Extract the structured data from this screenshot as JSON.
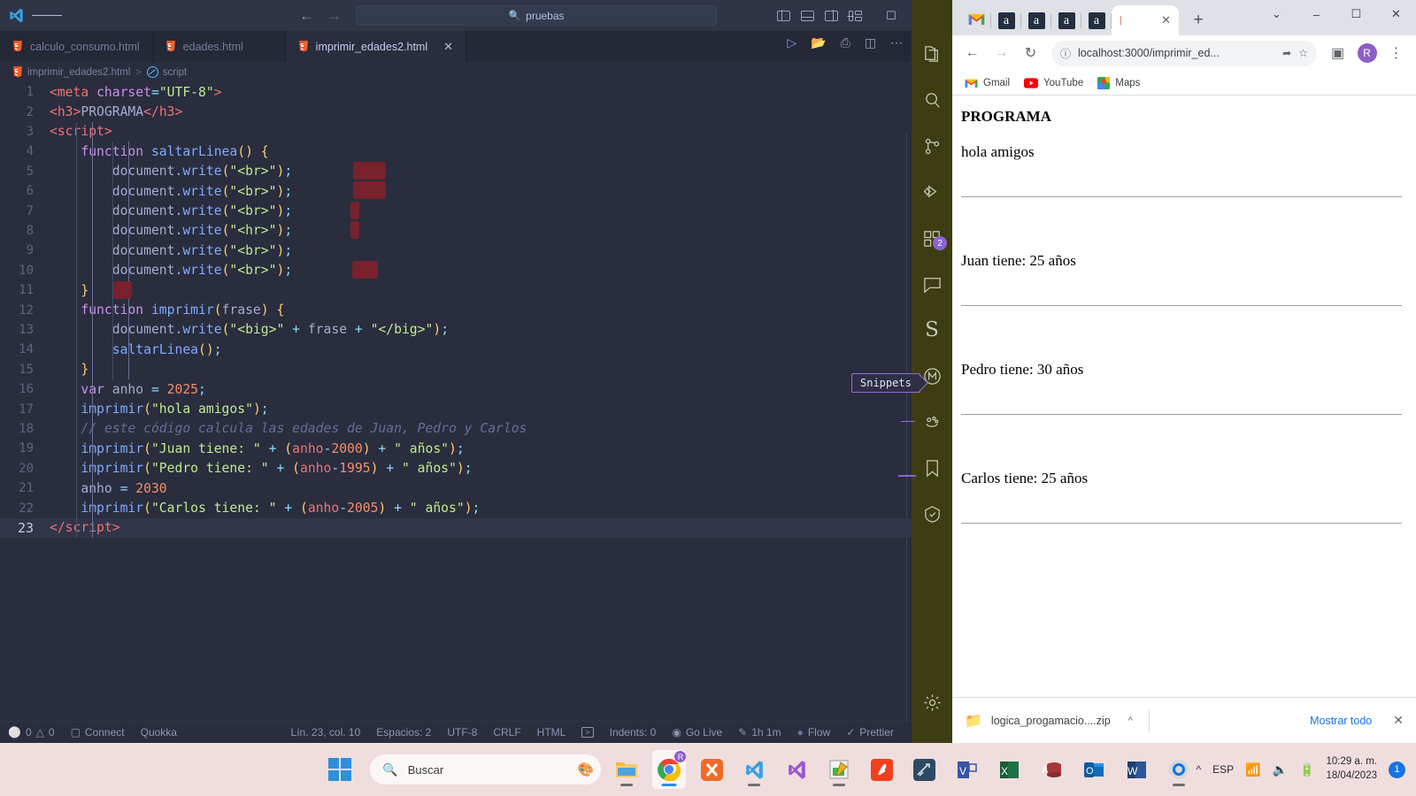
{
  "vscode": {
    "window_title": "pruebas",
    "search_placeholder": "pruebas",
    "tabs": [
      {
        "label": "calculo_consumo.html",
        "active": false
      },
      {
        "label": "edades.html",
        "active": false
      },
      {
        "label": "imprimir_edades2.html",
        "active": true
      }
    ],
    "breadcrumb": {
      "file": "imprimir_edades2.html",
      "symbol": "script",
      "separator": ">"
    },
    "tooltip": "Snippets",
    "code_lines": [
      {
        "n": "1",
        "html": "<span class='t-tag'>&lt;meta</span> <span class='t-attr'>charset</span><span class='t-op'>=</span><span class='t-str'>\"UTF-8\"</span><span class='t-tag'>&gt;</span>"
      },
      {
        "n": "2",
        "html": "<span class='t-tag'>&lt;h3&gt;</span><span class='t-pl'>PROGRAMA</span><span class='t-tag'>&lt;/</span><span class='t-tag'>h3&gt;</span>"
      },
      {
        "n": "3",
        "html": "<span class='t-tag'>&lt;script&gt;</span>"
      },
      {
        "n": "4",
        "html": "    <span class='t-kw'>function</span> <span class='t-fn'>saltarLinea</span><span class='t-par'>()</span> <span class='t-par'>{</span>"
      },
      {
        "n": "5",
        "html": "        <span class='t-var'>document</span><span class='t-pl'>.</span><span class='t-prop'>write</span><span class='t-par'>(</span><span class='t-str'>\"&lt;br&gt;\"</span><span class='t-par'>)</span><span class='t-op'>;</span>"
      },
      {
        "n": "6",
        "html": "        <span class='t-var'>document</span><span class='t-pl'>.</span><span class='t-prop'>write</span><span class='t-par'>(</span><span class='t-str'>\"&lt;br&gt;\"</span><span class='t-par'>)</span><span class='t-op'>;</span>"
      },
      {
        "n": "7",
        "html": "        <span class='t-var'>document</span><span class='t-pl'>.</span><span class='t-prop'>write</span><span class='t-par'>(</span><span class='t-str'>\"&lt;br&gt;\"</span><span class='t-par'>)</span><span class='t-op'>;</span>"
      },
      {
        "n": "8",
        "html": "        <span class='t-var'>document</span><span class='t-pl'>.</span><span class='t-prop'>write</span><span class='t-par'>(</span><span class='t-str'>\"&lt;hr&gt;\"</span><span class='t-par'>)</span><span class='t-op'>;</span>"
      },
      {
        "n": "9",
        "html": "        <span class='t-var'>document</span><span class='t-pl'>.</span><span class='t-prop'>write</span><span class='t-par'>(</span><span class='t-str'>\"&lt;br&gt;\"</span><span class='t-par'>)</span><span class='t-op'>;</span>"
      },
      {
        "n": "10",
        "html": "        <span class='t-var'>document</span><span class='t-pl'>.</span><span class='t-prop'>write</span><span class='t-par'>(</span><span class='t-str'>\"&lt;br&gt;\"</span><span class='t-par'>)</span><span class='t-op'>;</span>"
      },
      {
        "n": "11",
        "html": "    <span class='t-par'>}</span>"
      },
      {
        "n": "12",
        "html": "    <span class='t-kw'>function</span> <span class='t-fn'>imprimir</span><span class='t-par'>(</span><span class='t-pl'>frase</span><span class='t-par'>)</span> <span class='t-par'>{</span>"
      },
      {
        "n": "13",
        "html": "        <span class='t-var'>document</span><span class='t-pl'>.</span><span class='t-prop'>write</span><span class='t-par'>(</span><span class='t-str'>\"&lt;big&gt;\"</span> <span class='t-op'>+</span> <span class='t-pl'>frase</span> <span class='t-op'>+</span> <span class='t-str'>\"&lt;/big&gt;\"</span><span class='t-par'>)</span><span class='t-op'>;</span>"
      },
      {
        "n": "14",
        "html": "        <span class='t-fn'>saltarLinea</span><span class='t-par'>()</span><span class='t-op'>;</span>"
      },
      {
        "n": "15",
        "html": "    <span class='t-par'>}</span>"
      },
      {
        "n": "16",
        "html": "    <span class='t-kw'>var</span> <span class='t-pl'>anho</span> <span class='t-op'>=</span> <span class='t-num'>2025</span><span class='t-op'>;</span>"
      },
      {
        "n": "17",
        "html": "    <span class='t-fn'>imprimir</span><span class='t-par'>(</span><span class='t-str'>\"hola amigos\"</span><span class='t-par'>)</span><span class='t-op'>;</span>"
      },
      {
        "n": "18",
        "html": "    <span class='t-com'>// este código calcula las edades de Juan, Pedro y Carlos</span>"
      },
      {
        "n": "19",
        "html": "    <span class='t-fn'>imprimir</span><span class='t-par'>(</span><span class='t-str'>\"Juan tiene: \"</span> <span class='t-op'>+</span> <span class='t-par'>(</span><span class='t-tag'>anho</span><span class='t-op'>-</span><span class='t-num'>2000</span><span class='t-par'>)</span> <span class='t-op'>+</span> <span class='t-str'>\" años\"</span><span class='t-par'>)</span><span class='t-op'>;</span>"
      },
      {
        "n": "20",
        "html": "    <span class='t-fn'>imprimir</span><span class='t-par'>(</span><span class='t-str'>\"Pedro tiene: \"</span> <span class='t-op'>+</span> <span class='t-par'>(</span><span class='t-tag'>anho</span><span class='t-op'>-</span><span class='t-num'>1995</span><span class='t-par'>)</span> <span class='t-op'>+</span> <span class='t-str'>\" años\"</span><span class='t-par'>)</span><span class='t-op'>;</span>"
      },
      {
        "n": "21",
        "html": "    <span class='t-pl'>anho</span> <span class='t-op'>=</span> <span class='t-num'>2030</span>"
      },
      {
        "n": "22",
        "html": "    <span class='t-fn'>imprimir</span><span class='t-par'>(</span><span class='t-str'>\"Carlos tiene: \"</span> <span class='t-op'>+</span> <span class='t-par'>(</span><span class='t-tag'>anho</span><span class='t-op'>-</span><span class='t-num'>2005</span><span class='t-par'>)</span> <span class='t-op'>+</span> <span class='t-str'>\" años\"</span><span class='t-par'>)</span><span class='t-op'>;</span>"
      },
      {
        "n": "23",
        "html": "<span class='t-tag'>&lt;/script&gt;</span>",
        "current": true
      }
    ],
    "status_bar": {
      "errors": "0",
      "warnings": "0",
      "connect": "Connect",
      "quokka": "Quokka",
      "cursor": "Lín. 23, col. 10",
      "spaces": "Espacios: 2",
      "encoding": "UTF-8",
      "eol": "CRLF",
      "language": "HTML",
      "indents": "Indents: 0",
      "golive": "Go Live",
      "wakatime": "1h 1m",
      "flow": "Flow",
      "prettier": "Prettier"
    },
    "activity_bar": {
      "items": [
        {
          "name": "explorer",
          "badge": ""
        },
        {
          "name": "search",
          "badge": ""
        },
        {
          "name": "source-control",
          "badge": ""
        },
        {
          "name": "run-and-debug",
          "badge": ""
        },
        {
          "name": "extensions",
          "badge": "2"
        },
        {
          "name": "chat",
          "badge": ""
        },
        {
          "name": "snippets",
          "badge": ""
        },
        {
          "name": "marquee",
          "badge": ""
        },
        {
          "name": "bugs",
          "badge": ""
        },
        {
          "name": "bookmarks",
          "badge": ""
        },
        {
          "name": "checkmark",
          "badge": ""
        }
      ],
      "settings_label": "Settings"
    },
    "colors": {
      "editor_bg": "#292d3e",
      "activity_bar_bg": "#3d3d13",
      "selection": "#79212c",
      "accent": "#8a63d2"
    }
  },
  "chrome": {
    "tabs": [
      {
        "icon": "gmail-icon",
        "label": ""
      },
      {
        "icon": "amazon-icon",
        "label": "a"
      },
      {
        "icon": "amazon-icon",
        "label": "a"
      },
      {
        "icon": "amazon-icon",
        "label": "a"
      },
      {
        "icon": "amazon-icon",
        "label": "a"
      },
      {
        "icon": "active-tab",
        "label": "",
        "active": true
      }
    ],
    "new_tab_label": "+",
    "url": "localhost:3000/imprimir_ed...",
    "profile_initial": "R",
    "bookmarks": [
      {
        "label": "Gmail",
        "icon": "gmail-icon"
      },
      {
        "label": "YouTube",
        "icon": "youtube-icon"
      },
      {
        "label": "Maps",
        "icon": "maps-icon"
      }
    ],
    "page": {
      "heading": "PROGRAMA",
      "lines": [
        "hola amigos",
        "Juan tiene: 25 años",
        "Pedro tiene: 30 años",
        "Carlos tiene: 25 años"
      ]
    },
    "download_bar": {
      "file_name": "logica_progamacio....zip",
      "show_all": "Mostrar todo"
    }
  },
  "taskbar": {
    "search_placeholder": "Buscar",
    "apps": [
      {
        "name": "file-explorer"
      },
      {
        "name": "google-chrome"
      },
      {
        "name": "xampp"
      },
      {
        "name": "vscode"
      },
      {
        "name": "visual-studio"
      },
      {
        "name": "notepad-editor"
      },
      {
        "name": "pdf-app"
      },
      {
        "name": "drawing-app"
      },
      {
        "name": "visio"
      },
      {
        "name": "excel"
      },
      {
        "name": "access"
      },
      {
        "name": "outlook"
      },
      {
        "name": "word"
      },
      {
        "name": "settings"
      }
    ],
    "tray": {
      "language": "ESP",
      "time": "10:29 a. m.",
      "date": "18/04/2023",
      "notification_count": "1"
    }
  }
}
